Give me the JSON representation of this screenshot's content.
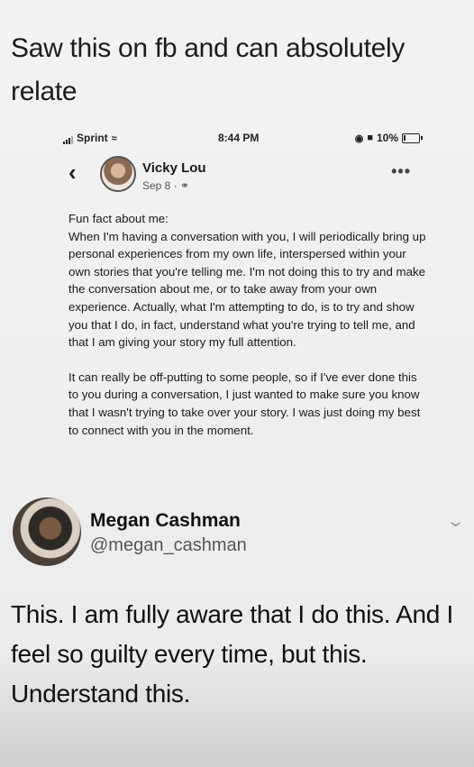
{
  "caption": "Saw this on fb and can absolutely relate",
  "status_bar": {
    "carrier": "Sprint",
    "time": "8:44 PM",
    "battery": "10%"
  },
  "fb_post": {
    "author": "Vicky Lou",
    "date": "Sep 8 ·",
    "paragraphs": [
      "Fun fact about me:\nWhen I'm having a conversation with you, I will periodically bring up personal experiences from my own life, interspersed within your own stories that you're telling me. I'm not doing this to try and make the conversation about me, or to take away from your own experience. Actually, what I'm attempting to do, is to try and show you that I do, in fact, understand what you're trying to tell me, and that I am giving your story my full attention.",
      "It can really be off-putting to some people, so if I've ever done this to you during a conversation, I just wanted to make sure you know that I wasn't trying to take over your story. I was just doing my best to connect with you in the moment."
    ]
  },
  "tweet": {
    "name": "Megan Cashman",
    "handle": "@megan_cashman",
    "text": "This. I am fully aware that I do this. And I feel so guilty every time, but this. Understand this."
  },
  "icons": {
    "back": "chevron-left",
    "more": "ellipsis",
    "expand": "chevron-down"
  }
}
